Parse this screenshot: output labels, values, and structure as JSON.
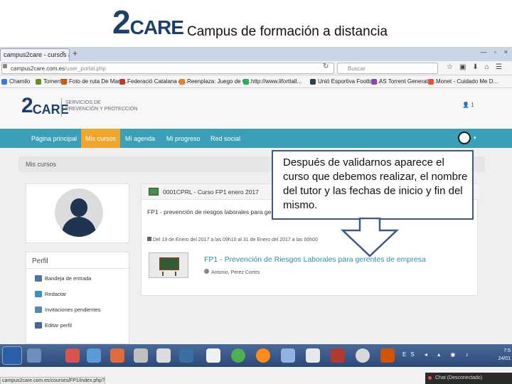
{
  "slide": {
    "logo_two": "2",
    "logo_care": "CARE",
    "subtitle": "Campus de formación a distancia"
  },
  "browser": {
    "tab_label": "campus2care - cursos a d...",
    "tab_close": "×",
    "tab_new": "+",
    "window_controls": "— ▫ ×",
    "url_host": "campus2care.com.es",
    "url_path": "/user_portal.php",
    "search_placeholder": "Buscar",
    "bookmarks": [
      {
        "label": "Chamilo",
        "color": "#3a7bd5"
      },
      {
        "label": "Tomen5C",
        "color": "#6b8e23"
      },
      {
        "label": "Foto de ruta De Martí...",
        "color": "#d35400"
      },
      {
        "label": "Federació Catalana d'...",
        "color": "#c0392b"
      },
      {
        "label": "Reenplaza: Juego de C...",
        "color": "#e67e22"
      },
      {
        "label": "http://www.liforttall...",
        "color": "#27ae60"
      },
      {
        "label": "Unió Esportiva Football...",
        "color": "#2c3e50"
      },
      {
        "label": "AS Torrent Generator...",
        "color": "#8e44ad"
      },
      {
        "label": "Monet - Cuidado Me D...",
        "color": "#e74c3c"
      }
    ]
  },
  "site": {
    "logo_two": "2",
    "logo_care": "CARE",
    "tagline_line1": "SERVICIOS DE",
    "tagline_line2": "PREVENCIÓN Y PROTECCIÓN",
    "user_count": "1",
    "nav": [
      {
        "label": "Página principal",
        "active": false
      },
      {
        "label": "Mis cursos",
        "active": true
      },
      {
        "label": "Mi agenda",
        "active": false
      },
      {
        "label": "Mi progreso",
        "active": false
      },
      {
        "label": "Red social",
        "active": false
      }
    ],
    "nav_caret": "▾",
    "breadcrumb": "Mis cursos"
  },
  "perfil": {
    "title": "Perfil",
    "items": [
      {
        "label": "Bandeja de entrada",
        "color": "#4a74a8"
      },
      {
        "label": "Redactar",
        "color": "#3b8ec8"
      },
      {
        "label": "Invitaciones pendientes",
        "color": "#5a86b5"
      },
      {
        "label": "Editar perfil",
        "color": "#4666a0"
      }
    ]
  },
  "course": {
    "header": "0001CPRL - Curso FP1 enero 2017",
    "subtitle": "FP1 - prevención de riesgos laborales para gerentes de empresa",
    "dates": "Del 19 de Enero del 2017 a las 09h10 al 31 de Enero del 2017 a las 00h00",
    "title_link": "FP1 - Prevención de Riesgos Laborales para gerentes de empresa",
    "teacher": "Antonio, Perez Cortes"
  },
  "chat": {
    "label": "Chat (Desconectado)"
  },
  "status_url": "campus2care.com.es/courses/FP1/index.php?id_session=0",
  "taskbar": {
    "tray": "ES ◂ ▴ ◉ ♪",
    "time": "7:5",
    "date": "24/01"
  },
  "callout": {
    "text": "Después de validarnos aparece el curso que debemos realizar, el nombre del tutor y las fechas de inicio y fin del mismo."
  }
}
